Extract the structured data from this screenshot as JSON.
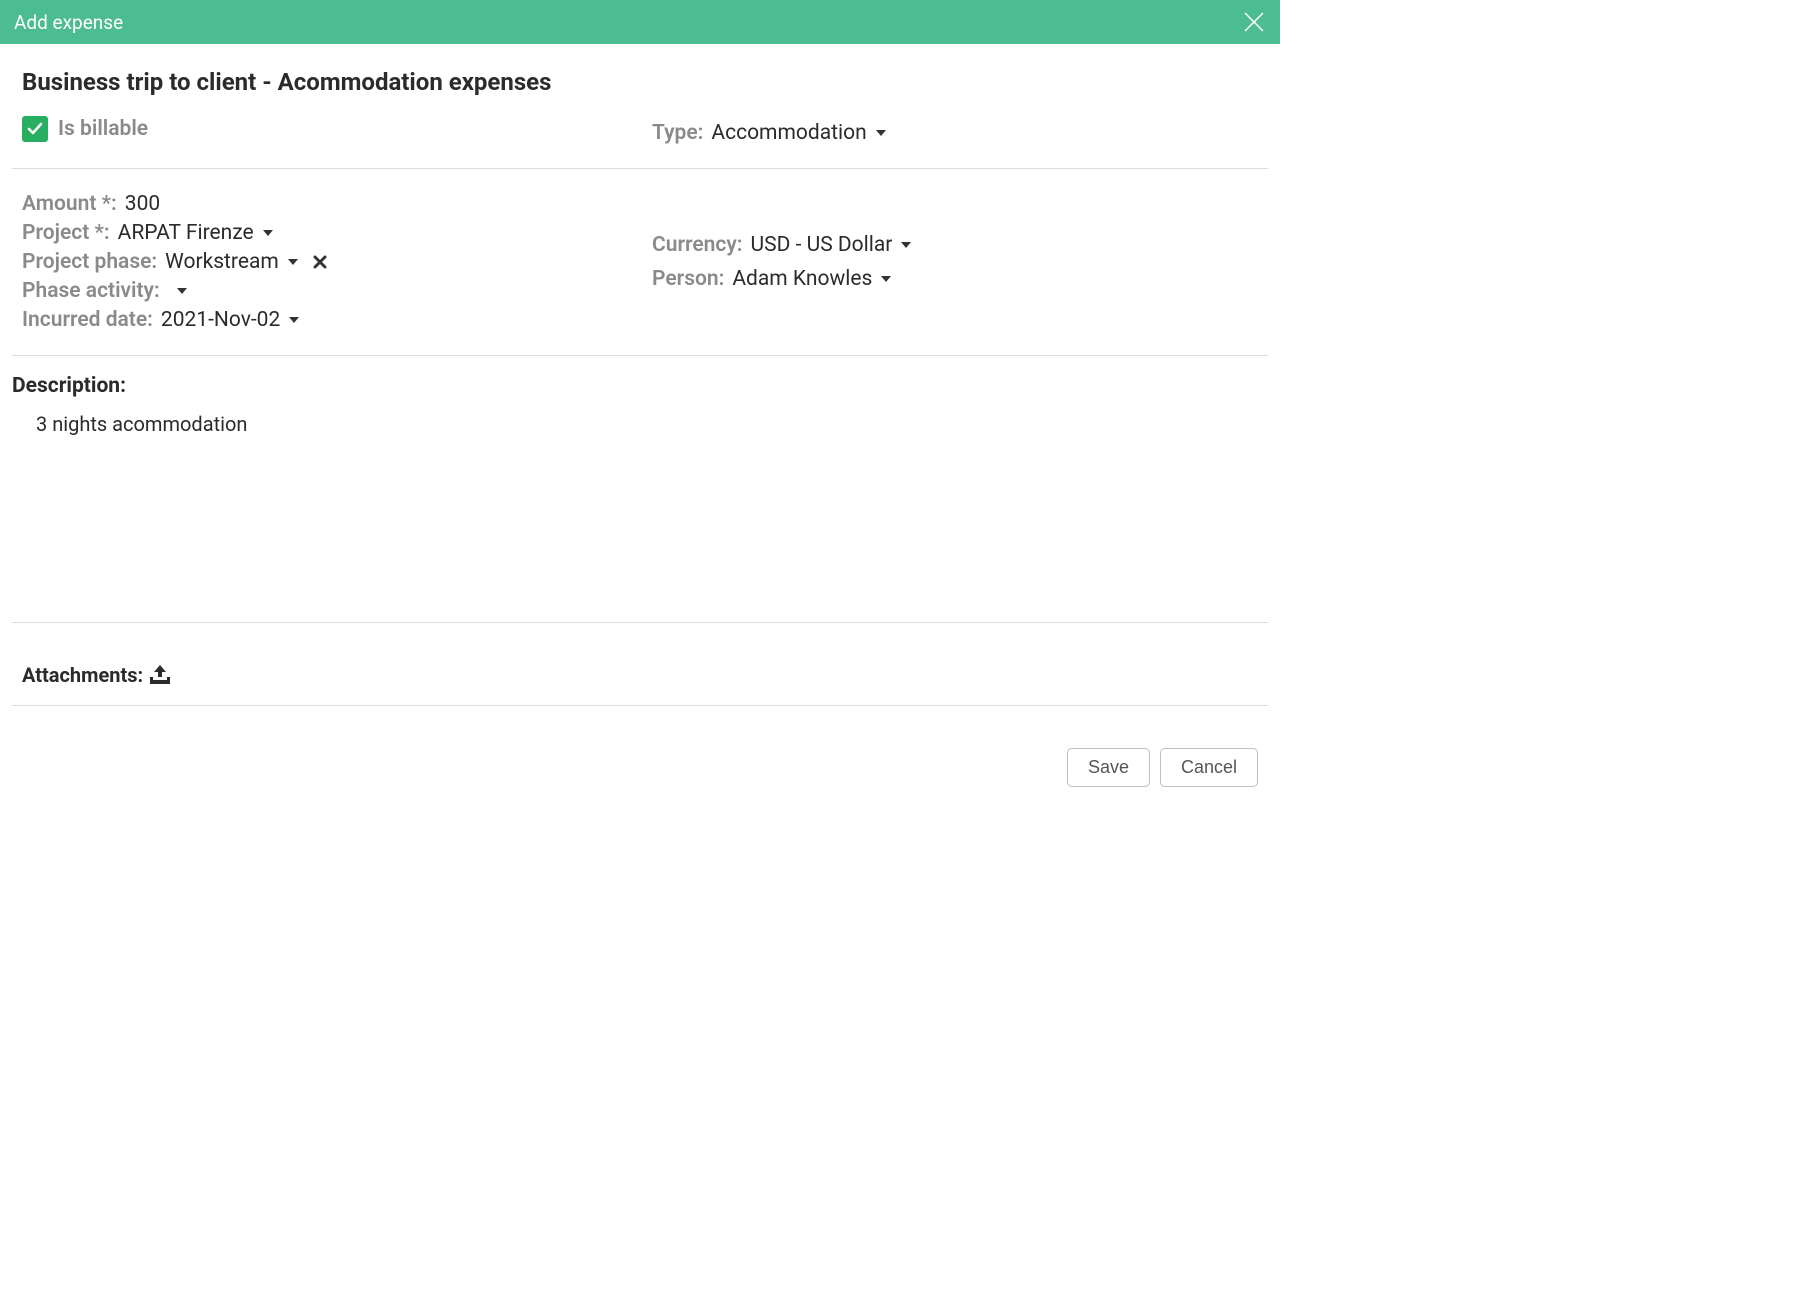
{
  "header": {
    "title": "Add expense"
  },
  "expense": {
    "title": "Business trip to client - Acommodation expenses",
    "is_billable_label": "Is billable",
    "type_label": "Type:",
    "type_value": "Accommodation",
    "amount_label": "Amount *:",
    "amount_value": "300",
    "project_label": "Project *:",
    "project_value": "ARPAT Firenze",
    "phase_label": "Project phase:",
    "phase_value": "Workstream",
    "activity_label": "Phase activity:",
    "activity_value": "",
    "incurred_label": "Incurred date:",
    "incurred_value": "2021-Nov-02",
    "currency_label": "Currency:",
    "currency_value": "USD - US Dollar",
    "person_label": "Person:",
    "person_value": "Adam Knowles",
    "description_heading": "Description:",
    "description_text": "3 nights acommodation",
    "attachments_label": "Attachments:"
  },
  "footer": {
    "save_label": "Save",
    "cancel_label": "Cancel"
  }
}
